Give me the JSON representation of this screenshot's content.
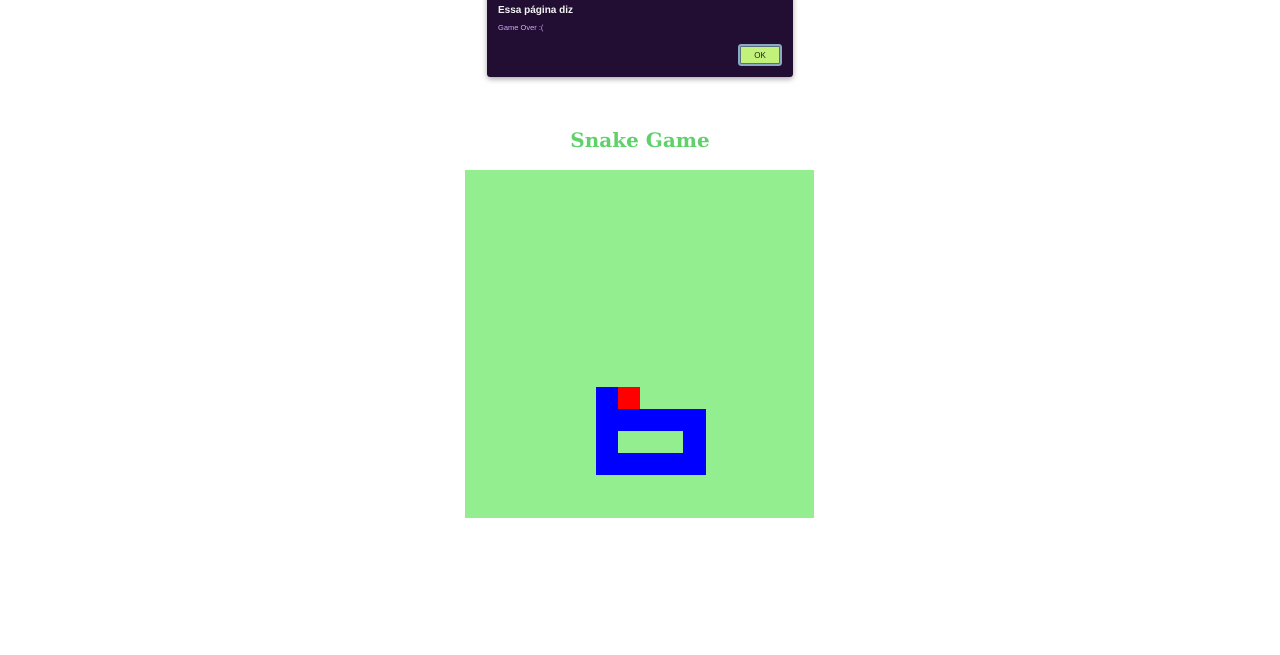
{
  "alert": {
    "title": "Essa página diz",
    "message": "Game Over :(",
    "ok_label": "OK"
  },
  "game": {
    "title": "Snake Game",
    "colors": {
      "board": "#93ee90",
      "snake": "#0000ff",
      "food": "#ff0000",
      "title": "#5fd06a"
    }
  }
}
